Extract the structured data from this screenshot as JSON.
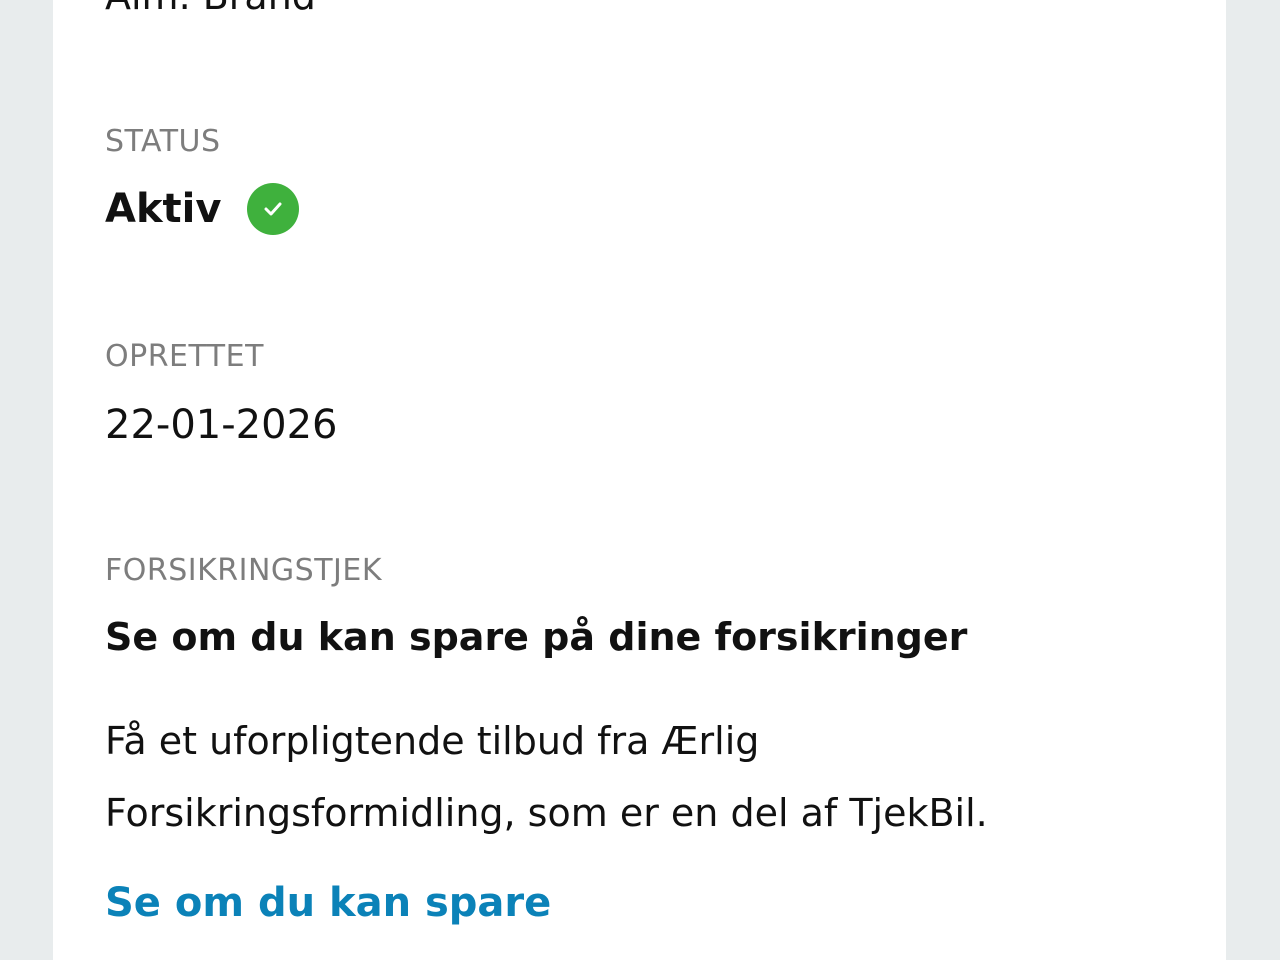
{
  "top_partial": {
    "value": "Alm. Brand"
  },
  "status": {
    "label": "STATUS",
    "value": "Aktiv",
    "icon": "check-circle-icon",
    "icon_color": "#3fb13d"
  },
  "created": {
    "label": "OPRETTET",
    "value": "22-01-2026"
  },
  "insurance_check": {
    "label": "FORSIKRINGSTJEK",
    "heading": "Se om du kan spare på dine forsikringer",
    "body": "Få et uforpligtende tilbud fra Ærlig Forsikringsformidling, som er en del af TjekBil.",
    "link": "Se om du kan spare",
    "link_color": "#0b82b8"
  }
}
